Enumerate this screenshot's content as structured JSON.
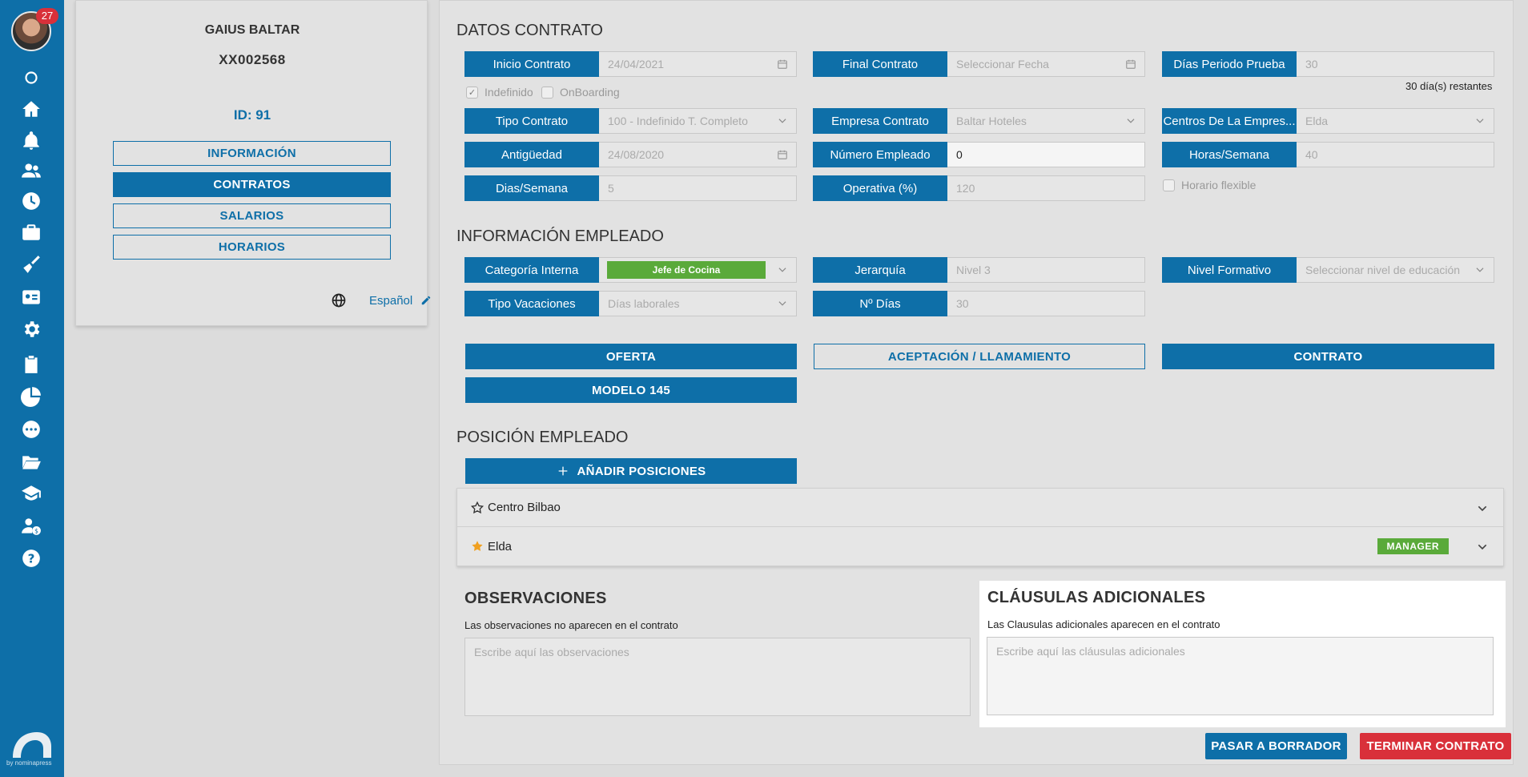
{
  "sidebar": {
    "notification_count": "27",
    "brand_text": "by nominapress",
    "icons": [
      "circle-icon",
      "home-icon",
      "bell-icon",
      "people-icon",
      "clock-icon",
      "briefcase-icon",
      "broom-icon",
      "id-card-icon",
      "gear-icon",
      "clipboard-icon",
      "pie-chart-icon",
      "chat-icon",
      "folder-open-icon",
      "graduation-cap-icon",
      "user-money-icon",
      "help-icon"
    ]
  },
  "employee": {
    "name": "GAIUS BALTAR",
    "code": "XX002568",
    "id": "ID: 91",
    "nav": [
      "INFORMACIÓN",
      "CONTRATOS",
      "SALARIOS",
      "HORARIOS"
    ],
    "active_nav": "CONTRATOS",
    "language": "Español"
  },
  "contract": {
    "title": "DATOS CONTRATO",
    "inicio_label": "Inicio Contrato",
    "inicio_value": "24/04/2021",
    "final_label": "Final Contrato",
    "final_placeholder": "Seleccionar Fecha",
    "prueba_label": "Días Periodo Prueba",
    "prueba_value": "30",
    "remaining": "30 día(s) restantes",
    "indefinido_label": "Indefinido",
    "onboarding_label": "OnBoarding",
    "tipo_label": "Tipo Contrato",
    "tipo_value": "100 - Indefinido T. Completo",
    "empresa_label": "Empresa Contrato",
    "empresa_value": "Baltar Hoteles",
    "centros_label": "Centros De La Empres...",
    "centros_value": "Elda",
    "antiguedad_label": "Antigüedad",
    "antiguedad_value": "24/08/2020",
    "numero_label": "Número Empleado",
    "numero_value": "0",
    "horas_label": "Horas/Semana",
    "horas_value": "40",
    "dias_label": "Dias/Semana",
    "dias_value": "5",
    "operativa_label": "Operativa (%)",
    "operativa_value": "120",
    "flexible_label": "Horario flexible"
  },
  "info": {
    "title": "INFORMACIÓN EMPLEADO",
    "categoria_label": "Categoría Interna",
    "categoria_value": "Jefe de Cocina",
    "jerarquia_label": "Jerarquía",
    "jerarquia_value": "Nivel 3",
    "formativo_label": "Nivel Formativo",
    "formativo_placeholder": "Seleccionar nivel de educación",
    "vacaciones_label": "Tipo Vacaciones",
    "vacaciones_value": "Días laborales",
    "ndias_label": "Nº Días",
    "ndias_value": "30"
  },
  "documents": {
    "oferta": "OFERTA",
    "aceptacion": "ACEPTACIÓN / LLAMAMIENTO",
    "contrato": "CONTRATO",
    "modelo": "MODELO 145"
  },
  "positions": {
    "title": "POSICIÓN EMPLEADO",
    "add_label": "AÑADIR POSICIONES",
    "items": [
      {
        "name": "Centro Bilbao",
        "badge": ""
      },
      {
        "name": "Elda",
        "badge": "MANAGER"
      }
    ]
  },
  "notes": {
    "obs_title": "OBSERVACIONES",
    "obs_sub": "Las observaciones no aparecen en el contrato",
    "obs_placeholder": "Escribe aquí las observaciones",
    "cla_title": "CLÁUSULAS ADICIONALES",
    "cla_sub": "Las Clausulas adicionales aparecen en el contrato",
    "cla_placeholder": "Escribe aquí las cláusulas adicionales"
  },
  "footer": {
    "draft": "PASAR A BORRADOR",
    "terminate": "TERMINAR CONTRATO"
  },
  "colors": {
    "primary": "#0e6fa8",
    "success": "#5aaa3a",
    "danger": "#d9303a",
    "star": "#f0a020"
  }
}
